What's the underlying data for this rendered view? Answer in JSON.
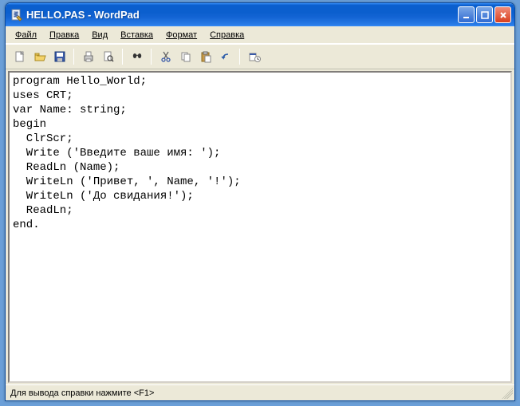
{
  "title": "HELLO.PAS - WordPad",
  "menu": {
    "file": "Файл",
    "edit": "Правка",
    "view": "Вид",
    "insert": "Вставка",
    "format": "Формат",
    "help": "Справка"
  },
  "toolbar": {
    "new": "new",
    "open": "open",
    "save": "save",
    "print": "print",
    "preview": "preview",
    "find": "find",
    "cut": "cut",
    "copy": "copy",
    "paste": "paste",
    "undo": "undo",
    "datetime": "datetime"
  },
  "editor": {
    "content": "program Hello_World;\nuses CRT;\nvar Name: string;\nbegin\n  ClrScr;\n  Write ('Введите ваше имя: ');\n  ReadLn (Name);\n  WriteLn ('Привет, ', Name, '!');\n  WriteLn ('До свидания!');\n  ReadLn;\nend."
  },
  "status": "Для вывода справки нажмите <F1>"
}
